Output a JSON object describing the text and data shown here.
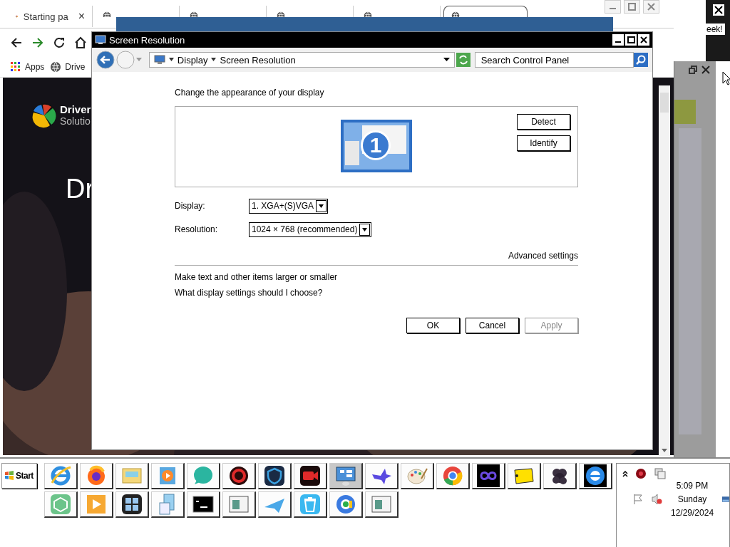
{
  "browser": {
    "tabs": [
      {
        "title": "Starting pa",
        "close": "×",
        "selected": false
      },
      {
        "selected": false
      },
      {
        "selected": false
      },
      {
        "selected": false
      },
      {
        "selected": false
      },
      {
        "selected": true
      }
    ],
    "bookmarks": [
      {
        "label": "Apps"
      },
      {
        "label": "Drive"
      }
    ],
    "page": {
      "logo_line1": "Driver",
      "logo_line2": "Solutio",
      "heading": "Dr"
    },
    "side_text": "eek!"
  },
  "dialog": {
    "title": "Screen Resolution",
    "breadcrumb": [
      "Display",
      "Screen Resolution"
    ],
    "search": {
      "placeholder": "Search Control Panel"
    },
    "heading": "Change the appearance of your display",
    "monitor_number": "1",
    "preview_buttons": [
      "Detect",
      "Identify"
    ],
    "fields": [
      {
        "label": "Display:",
        "value": "1. XGA+(S)VGA"
      },
      {
        "label": "Resolution:",
        "value": "1024 × 768 (recommended)"
      }
    ],
    "advanced_link": "Advanced settings",
    "links": [
      "Make text and other items larger or smaller",
      "What display settings should I choose?"
    ],
    "buttons": [
      {
        "label": "OK",
        "disabled": false
      },
      {
        "label": "Cancel",
        "disabled": false
      },
      {
        "label": "Apply",
        "disabled": true
      }
    ]
  },
  "taskbar": {
    "start": "Start",
    "buttons": [
      {
        "selected": false
      },
      {
        "selected": false
      },
      {
        "selected": false
      },
      {
        "selected": false
      },
      {
        "selected": false
      },
      {
        "selected": false
      },
      {
        "selected": false
      },
      {
        "selected": false
      },
      {
        "selected": true
      },
      {
        "selected": false
      },
      {
        "selected": false
      },
      {
        "selected": false
      },
      {
        "selected": false
      },
      {
        "selected": false
      },
      {
        "selected": false
      },
      {
        "selected": false
      },
      {
        "selected": false
      },
      {
        "selected": false
      },
      {
        "selected": false
      },
      {
        "selected": false
      },
      {
        "selected": false
      },
      {
        "selected": false
      },
      {
        "selected": false
      },
      {
        "selected": false
      },
      {
        "selected": false
      },
      {
        "selected": false
      }
    ],
    "clock": {
      "time": "5:09 PM",
      "day": "Sunday",
      "date": "12/29/2024"
    }
  }
}
